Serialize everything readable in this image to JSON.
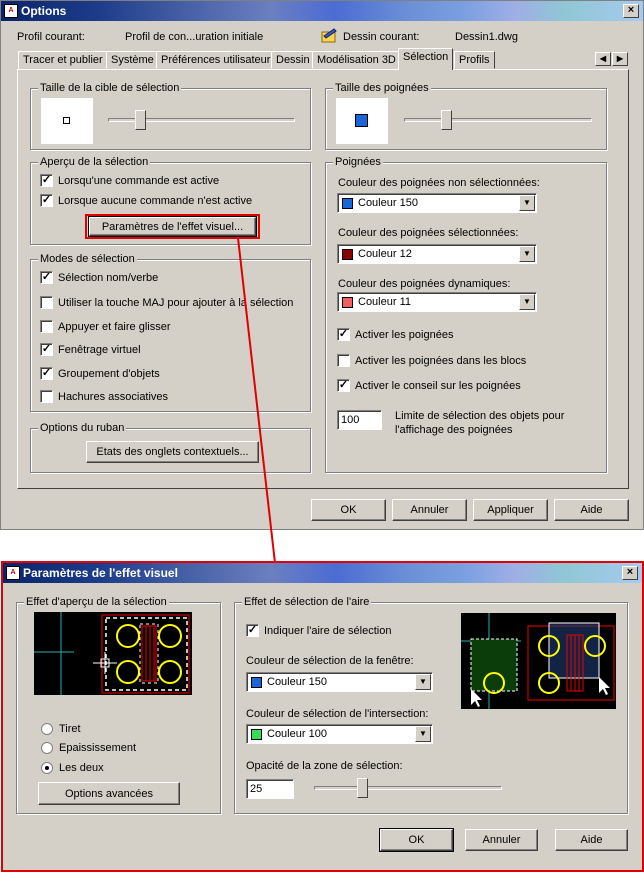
{
  "options_window": {
    "title": "Options",
    "profile_label": "Profil courant:",
    "profile_value": "Profil de con...uration initiale",
    "drawing_label": "Dessin courant:",
    "drawing_value": "Dessin1.dwg",
    "tabs": [
      "Tracer et publier",
      "Système",
      "Préférences utilisateur",
      "Dessin",
      "Modélisation 3D",
      "Sélection",
      "Profils"
    ],
    "active_tab": "Sélection",
    "target_size_group": "Taille de la cible de sélection",
    "grip_size_group": "Taille des poignées",
    "preview_group": "Aperçu de la sélection",
    "preview_options": [
      {
        "label": "Lorsqu'une commande est active",
        "checked": true
      },
      {
        "label": "Lorsque aucune commande n'est active",
        "checked": true
      }
    ],
    "visual_effect_button": "Paramètres de l'effet visuel...",
    "modes_group": "Modes de sélection",
    "modes": [
      {
        "label": "Sélection nom/verbe",
        "checked": true
      },
      {
        "label": "Utiliser la touche MAJ pour ajouter à la sélection",
        "checked": false
      },
      {
        "label": "Appuyer et faire glisser",
        "checked": false
      },
      {
        "label": "Fenêtrage virtuel",
        "checked": true
      },
      {
        "label": "Groupement d'objets",
        "checked": true
      },
      {
        "label": "Hachures associatives",
        "checked": false
      }
    ],
    "ribbon_group": "Options du ruban",
    "ribbon_button": "Etats des onglets contextuels...",
    "grips_group": "Poignées",
    "unselected_label": "Couleur des poignées non sélectionnées:",
    "unselected_value": "Couleur 150",
    "selected_label": "Couleur des poignées sélectionnées:",
    "selected_value": "Couleur 12",
    "dynamic_label": "Couleur des poignées dynamiques:",
    "dynamic_value": "Couleur 11",
    "grip_checks": [
      {
        "label": "Activer les poignées",
        "checked": true
      },
      {
        "label": "Activer les poignées dans les blocs",
        "checked": false
      },
      {
        "label": "Activer le conseil sur les poignées",
        "checked": true
      }
    ],
    "limit_value": "100",
    "limit_label_1": "Limite de sélection des objets pour",
    "limit_label_2": "l'affichage des poignées",
    "ok": "OK",
    "cancel": "Annuler",
    "apply": "Appliquer",
    "help": "Aide"
  },
  "visual_window": {
    "title": "Paramètres de l'effet visuel",
    "preview_group": "Effet d'aperçu de la sélection",
    "radios": [
      {
        "label": "Tiret",
        "checked": false
      },
      {
        "label": "Epaississement",
        "checked": false
      },
      {
        "label": "Les deux",
        "checked": true
      }
    ],
    "advanced_button": "Options avancées",
    "area_group": "Effet de sélection de l'aire",
    "indicate_label": "Indiquer l'aire de sélection",
    "indicate_checked": true,
    "window_color_label": "Couleur de sélection de la fenêtre:",
    "window_color_value": "Couleur 150",
    "crossing_color_label": "Couleur de sélection de l'intersection:",
    "crossing_color_value": "Couleur 100",
    "opacity_label": "Opacité de la zone de sélection:",
    "opacity_value": "25",
    "ok": "OK",
    "cancel": "Annuler",
    "help": "Aide"
  },
  "colors": {
    "color150": "#1a66d9",
    "color12": "#8b0000",
    "color11": "#f06060",
    "color100": "#33dd55",
    "highlight_red": "#e00000"
  }
}
